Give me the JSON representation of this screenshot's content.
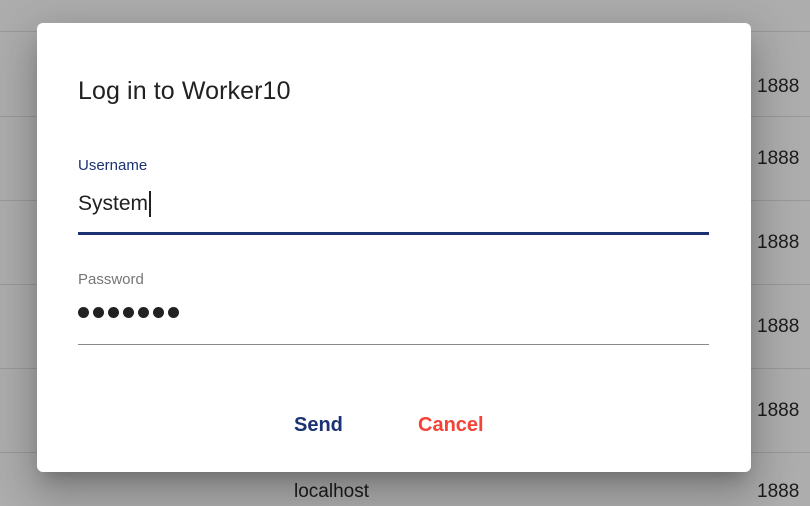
{
  "background": {
    "rows": [
      {
        "host": "",
        "port": "1888"
      },
      {
        "host": "",
        "port": "1888"
      },
      {
        "host": "",
        "port": "1888"
      },
      {
        "host": "",
        "port": "1888"
      },
      {
        "host": "",
        "port": "1888"
      },
      {
        "host": "localhost",
        "port": "1888"
      }
    ]
  },
  "dialog": {
    "title": "Log in to Worker10",
    "username": {
      "label": "Username",
      "value": "System"
    },
    "password": {
      "label": "Password",
      "masked_length": 7
    },
    "actions": {
      "send_label": "Send",
      "cancel_label": "Cancel"
    }
  },
  "colors": {
    "accent": "#1b3273",
    "warn": "#f44336"
  }
}
